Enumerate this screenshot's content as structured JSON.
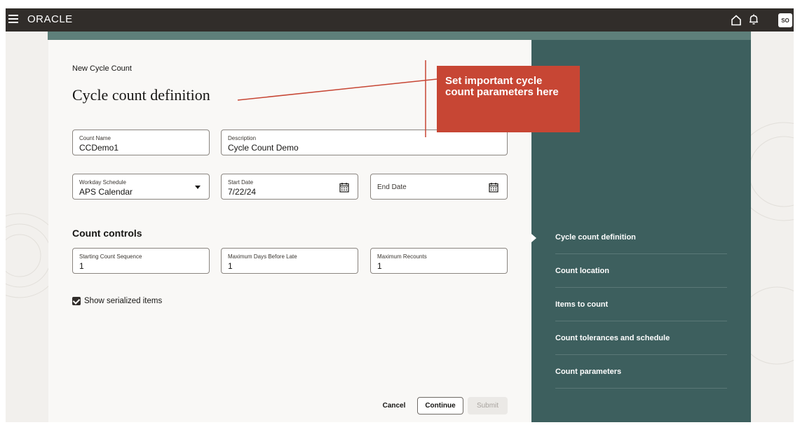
{
  "topbar": {
    "logo": "ORACLE",
    "avatar_initials": "SO",
    "menu_icon": "hamburger-icon",
    "home_icon": "home-icon",
    "notifications_icon": "bell-icon"
  },
  "page": {
    "breadcrumb": "New Cycle Count",
    "title": "Cycle count definition"
  },
  "fields": {
    "count_name": {
      "label": "Count Name",
      "value": "CCDemo1"
    },
    "description": {
      "label": "Description",
      "value": "Cycle Count Demo"
    },
    "workday_schedule": {
      "label": "Workday Schedule",
      "value": "APS Calendar"
    },
    "start_date": {
      "label": "Start Date",
      "value": "7/22/24"
    },
    "end_date": {
      "label": "End Date",
      "value": ""
    }
  },
  "count_controls": {
    "heading": "Count controls",
    "starting_count_sequence": {
      "label": "Starting Count Sequence",
      "value": "1"
    },
    "max_days_before_late": {
      "label": "Maximum Days Before Late",
      "value": "1"
    },
    "max_recounts": {
      "label": "Maximum Recounts",
      "value": "1"
    }
  },
  "show_serialized": {
    "label": "Show serialized items",
    "checked": true
  },
  "actions": {
    "cancel": "Cancel",
    "continue": "Continue",
    "submit": "Submit"
  },
  "steps": [
    {
      "label": "Cycle count definition",
      "current": true
    },
    {
      "label": "Count location",
      "current": false
    },
    {
      "label": "Items to count",
      "current": false
    },
    {
      "label": "Count tolerances and schedule",
      "current": false
    },
    {
      "label": "Count parameters",
      "current": false
    }
  ],
  "annotation": {
    "text": "Set important cycle count parameters here"
  },
  "colors": {
    "topbar": "#312d2a",
    "side_panel": "#3d5f5e",
    "callout": "#c74634",
    "card": "#f9f8f6"
  }
}
